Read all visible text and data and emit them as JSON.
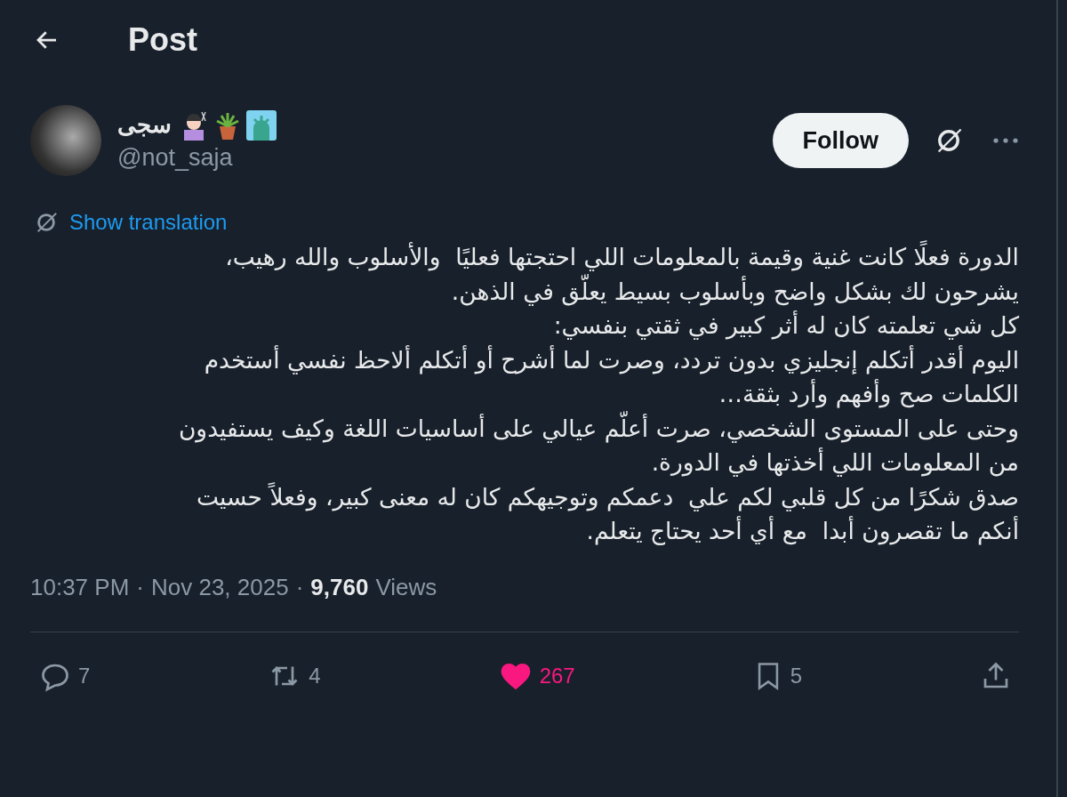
{
  "header": {
    "title": "Post"
  },
  "author": {
    "display_name": "سجى",
    "handle": "@not_saja"
  },
  "follow_button": {
    "label": "Follow"
  },
  "translation_link": {
    "label": "Show translation"
  },
  "body": {
    "lines": [
      "الدورة فعلًا كانت غنية وقيمة بالمعلومات اللي احتجتها فعليًا  والأسلوب والله رهيب،",
      "يشرحون لك بشكل واضح وبأسلوب بسيط يعلّق في الذهن.",
      "كل شي تعلمته كان له أثر كبير في ثقتي بنفسي:",
      "اليوم أقدر أتكلم إنجليزي بدون تردد، وصرت لما أشرح أو أتكلم ألاحظ نفسي أستخدم",
      "الكلمات صح وأفهم وأرد بثقة…",
      "وحتى على المستوى الشخصي، صرت أعلّم عيالي على أساسيات اللغة وكيف يستفيدون",
      "من المعلومات اللي أخذتها في الدورة.",
      "صدق شكرًا من كل قلبي لكم علي  دعمكم وتوجيهكم كان له معنى كبير، وفعلاً حسيت",
      "أنكم ما تقصرون أبدا  مع أي أحد يحتاج يتعلم."
    ]
  },
  "meta": {
    "time": "10:37 PM",
    "separator_1": "·",
    "date": "Nov 23, 2025",
    "separator_2": "·",
    "views_count": "9,760",
    "views_label": "Views"
  },
  "actions": {
    "reply": {
      "count": "7",
      "active": false
    },
    "repost": {
      "count": "4",
      "active": false
    },
    "like": {
      "count": "267",
      "active": true
    },
    "bookmark": {
      "count": "5",
      "active": false
    },
    "share": {
      "active": false
    }
  }
}
